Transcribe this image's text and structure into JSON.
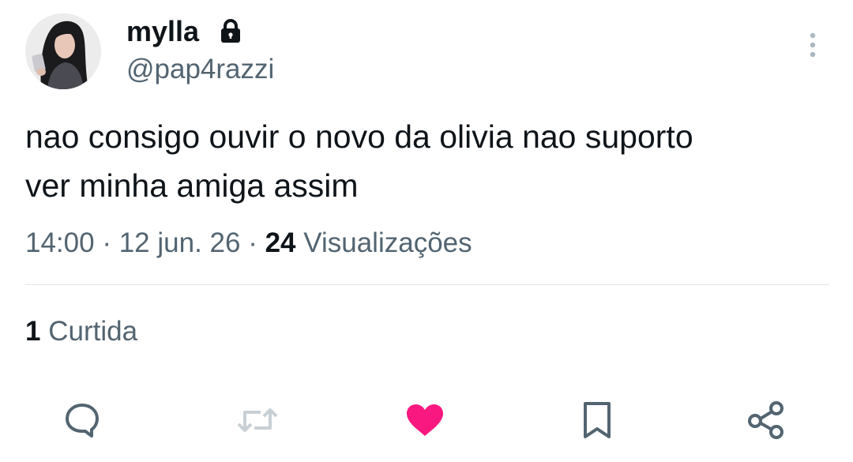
{
  "user": {
    "display_name": "mylla",
    "handle": "@pap4razzi",
    "protected_icon": "lock-icon",
    "avatar": "profile-photo"
  },
  "tweet": {
    "text": "nao consigo ouvir o novo da olivia nao suporto\nver minha amiga assim",
    "time": "14:00",
    "separator": "·",
    "date": "12 jun. 26",
    "views_count": "24",
    "views_label": "Visualizações"
  },
  "engagement": {
    "likes_count": "1",
    "likes_label": "Curtida"
  },
  "actions": {
    "reply_icon": "comment-icon",
    "retweet_icon": "retweet-icon",
    "like_icon": "heart-icon",
    "bookmark_icon": "bookmark-icon",
    "share_icon": "share-icon"
  },
  "colors": {
    "primary_text": "#0f1419",
    "secondary_text": "#536471",
    "icon_gray": "#536471",
    "liked_pink": "#f91880",
    "divider": "#e4e8eb"
  }
}
